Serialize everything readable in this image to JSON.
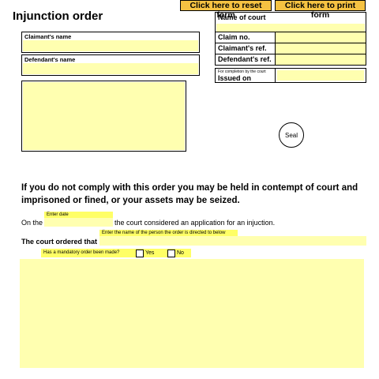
{
  "buttons": {
    "reset_label": "Click here to reset form",
    "print_label": "Click here to print form"
  },
  "title": "Injunction order",
  "claimant": {
    "label": "Claimant's name",
    "value": ""
  },
  "defendant": {
    "label": "Defendant's name",
    "value": ""
  },
  "court_table": {
    "name_of_court_label": "Name of court",
    "claim_no_label": "Claim no.",
    "claimants_ref_label": "Claimant's ref.",
    "defendants_ref_label": "Defendant's ref.",
    "completion_note": "For completion by the court",
    "issued_on_label": "Issued on"
  },
  "seal_label": "Seal",
  "warning": "If you do not comply with this order you may be held in contempt of court and imprisoned or fined, or your assets may be seized.",
  "on_the": {
    "prefix": "On the",
    "date_hint": "Enter date",
    "suffix": "the court considered an application for an injuction."
  },
  "ordered": {
    "label": "The court ordered that",
    "hint": "Enter the name of the person the order is directed to below"
  },
  "mandatory": {
    "question": "Has a mandatory order been made?",
    "yes": "Yes",
    "no": "No"
  },
  "colors": {
    "field_yellow": "#ffffb0",
    "highlight_yellow": "#ffff66",
    "button_orange": "#f5c242"
  }
}
